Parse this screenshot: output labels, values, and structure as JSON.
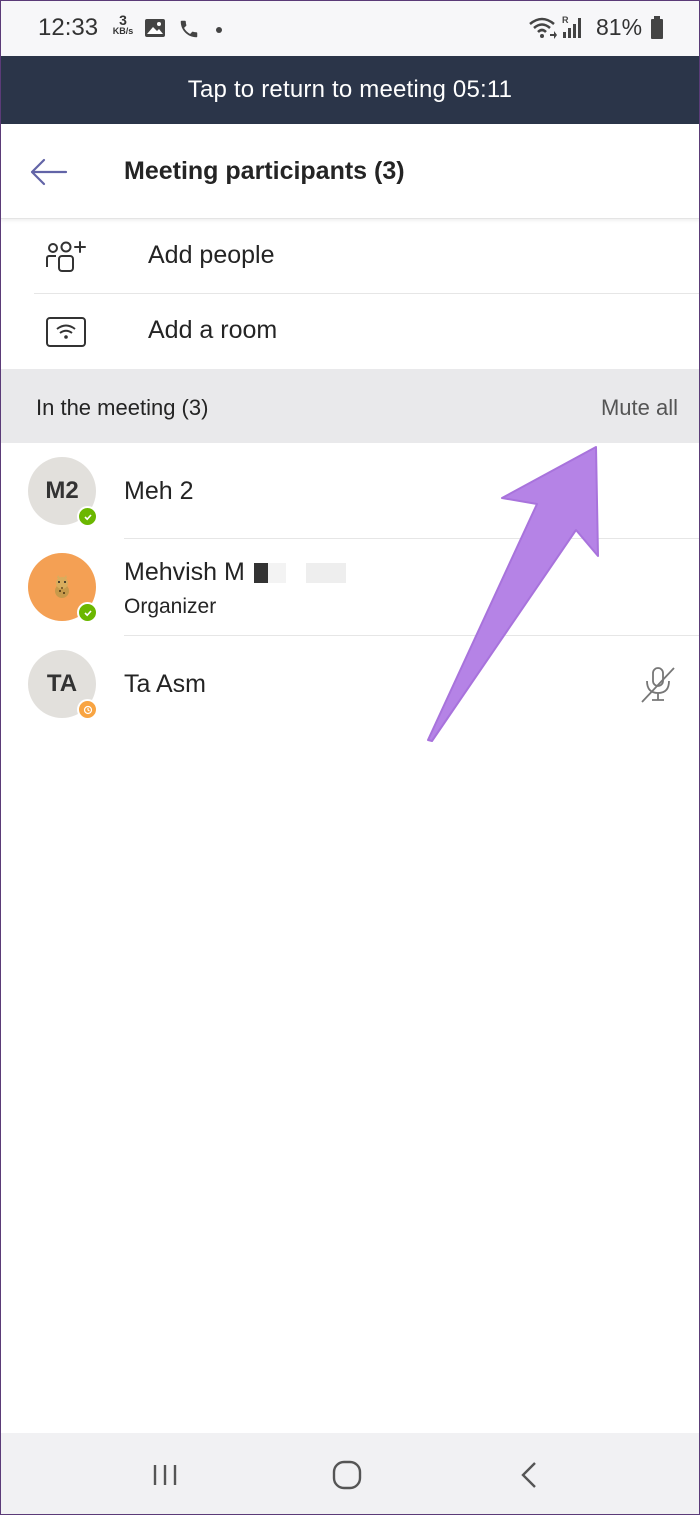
{
  "status_bar": {
    "time": "12:33",
    "net_speed_value": "3",
    "net_speed_unit": "KB/s",
    "battery": "81%",
    "icons": [
      "image-icon",
      "phone-icon",
      "dot-icon",
      "wifi-calling-icon",
      "signal-icon",
      "battery-icon"
    ]
  },
  "banner": {
    "text": "Tap to return to meeting 05:11"
  },
  "header": {
    "title": "Meeting participants (3)",
    "back_icon": "back-arrow-icon"
  },
  "actions": [
    {
      "label": "Add people",
      "icon": "add-people-icon"
    },
    {
      "label": "Add a room",
      "icon": "cast-room-icon"
    }
  ],
  "section": {
    "title": "In the meeting (3)",
    "mute_all": "Mute all"
  },
  "participants": [
    {
      "initials": "M2",
      "name": "Meh 2",
      "role": "",
      "presence": "available"
    },
    {
      "initials": "",
      "name": "Mehvish M",
      "role": "Organizer",
      "presence": "available"
    },
    {
      "initials": "TA",
      "name": "Ta Asm",
      "role": "",
      "presence": "away",
      "muted": true
    }
  ],
  "colors": {
    "banner_bg": "#2b3549",
    "accent_purple": "#6264a7",
    "presence_green": "#6bb700",
    "presence_away": "#f8a442",
    "annotation_arrow": "#b583e6"
  },
  "nav_bar": {
    "buttons": [
      "recents-icon",
      "home-icon",
      "back-icon"
    ]
  }
}
